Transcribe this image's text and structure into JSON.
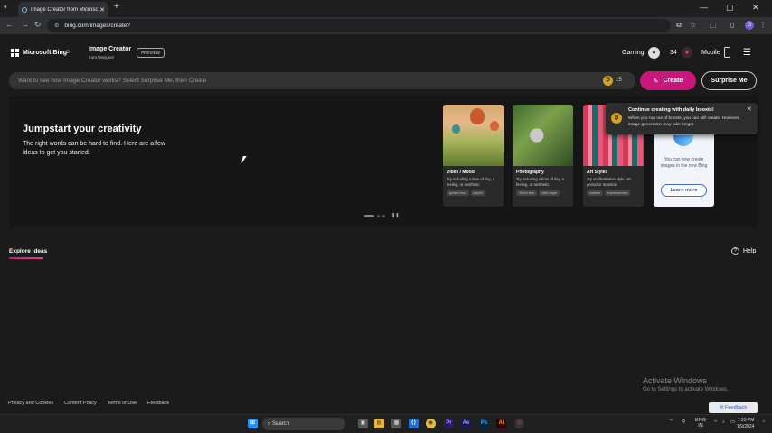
{
  "browser": {
    "tab_title": "Image Creator from Microsoft Designer",
    "url": "bing.com/images/create?"
  },
  "header": {
    "brand": "Microsoft Bing",
    "product_title": "Image Creator",
    "product_sub": "from Designer",
    "preview_badge": "PREVIEW",
    "gaming_label": "Gaming",
    "points": "34",
    "mobile_label": "Mobile"
  },
  "prompt": {
    "placeholder": "Want to see how Image Creator works? Select Surprise Me, then Create",
    "boost_count": "15",
    "create_label": "Create",
    "surprise_label": "Surprise Me"
  },
  "hero": {
    "title": "Jumpstart your creativity",
    "description": "The right words can be hard to find. Here are a few ideas to get you started.",
    "cards": [
      {
        "title": "Vibes / Mood",
        "desc": "Try including a time of day, a feeling, or aesthetic.",
        "chips": [
          "golden hour",
          "playful"
        ]
      },
      {
        "title": "Photography",
        "desc": "Try including a time of day, a feeling, or aesthetic.",
        "chips": [
          "35mm lens",
          "wide angle"
        ]
      },
      {
        "title": "Art Styles",
        "desc": "Try an illustration style, art period or material.",
        "chips": [
          "matisse",
          "impressionism"
        ]
      }
    ],
    "promo_text": "You can now create images in the new Bing",
    "promo_button": "Learn more"
  },
  "toast": {
    "title": "Continue creating with daily boosts!",
    "body": "When you run out of boosts, you can still create. However, image generation may take longer."
  },
  "explore_label": "Explore ideas",
  "help_label": "Help",
  "footer": {
    "links": [
      "Privacy and Cookies",
      "Content Policy",
      "Terms of Use",
      "Feedback"
    ],
    "feedback_button": "Feedback"
  },
  "watermark": {
    "line1": "Activate Windows",
    "line2": "Go to Settings to activate Windows."
  },
  "taskbar": {
    "search_label": "Search",
    "lang": "ENG",
    "region": "IN",
    "time": "7:23 PM",
    "date": "1/9/2024"
  }
}
